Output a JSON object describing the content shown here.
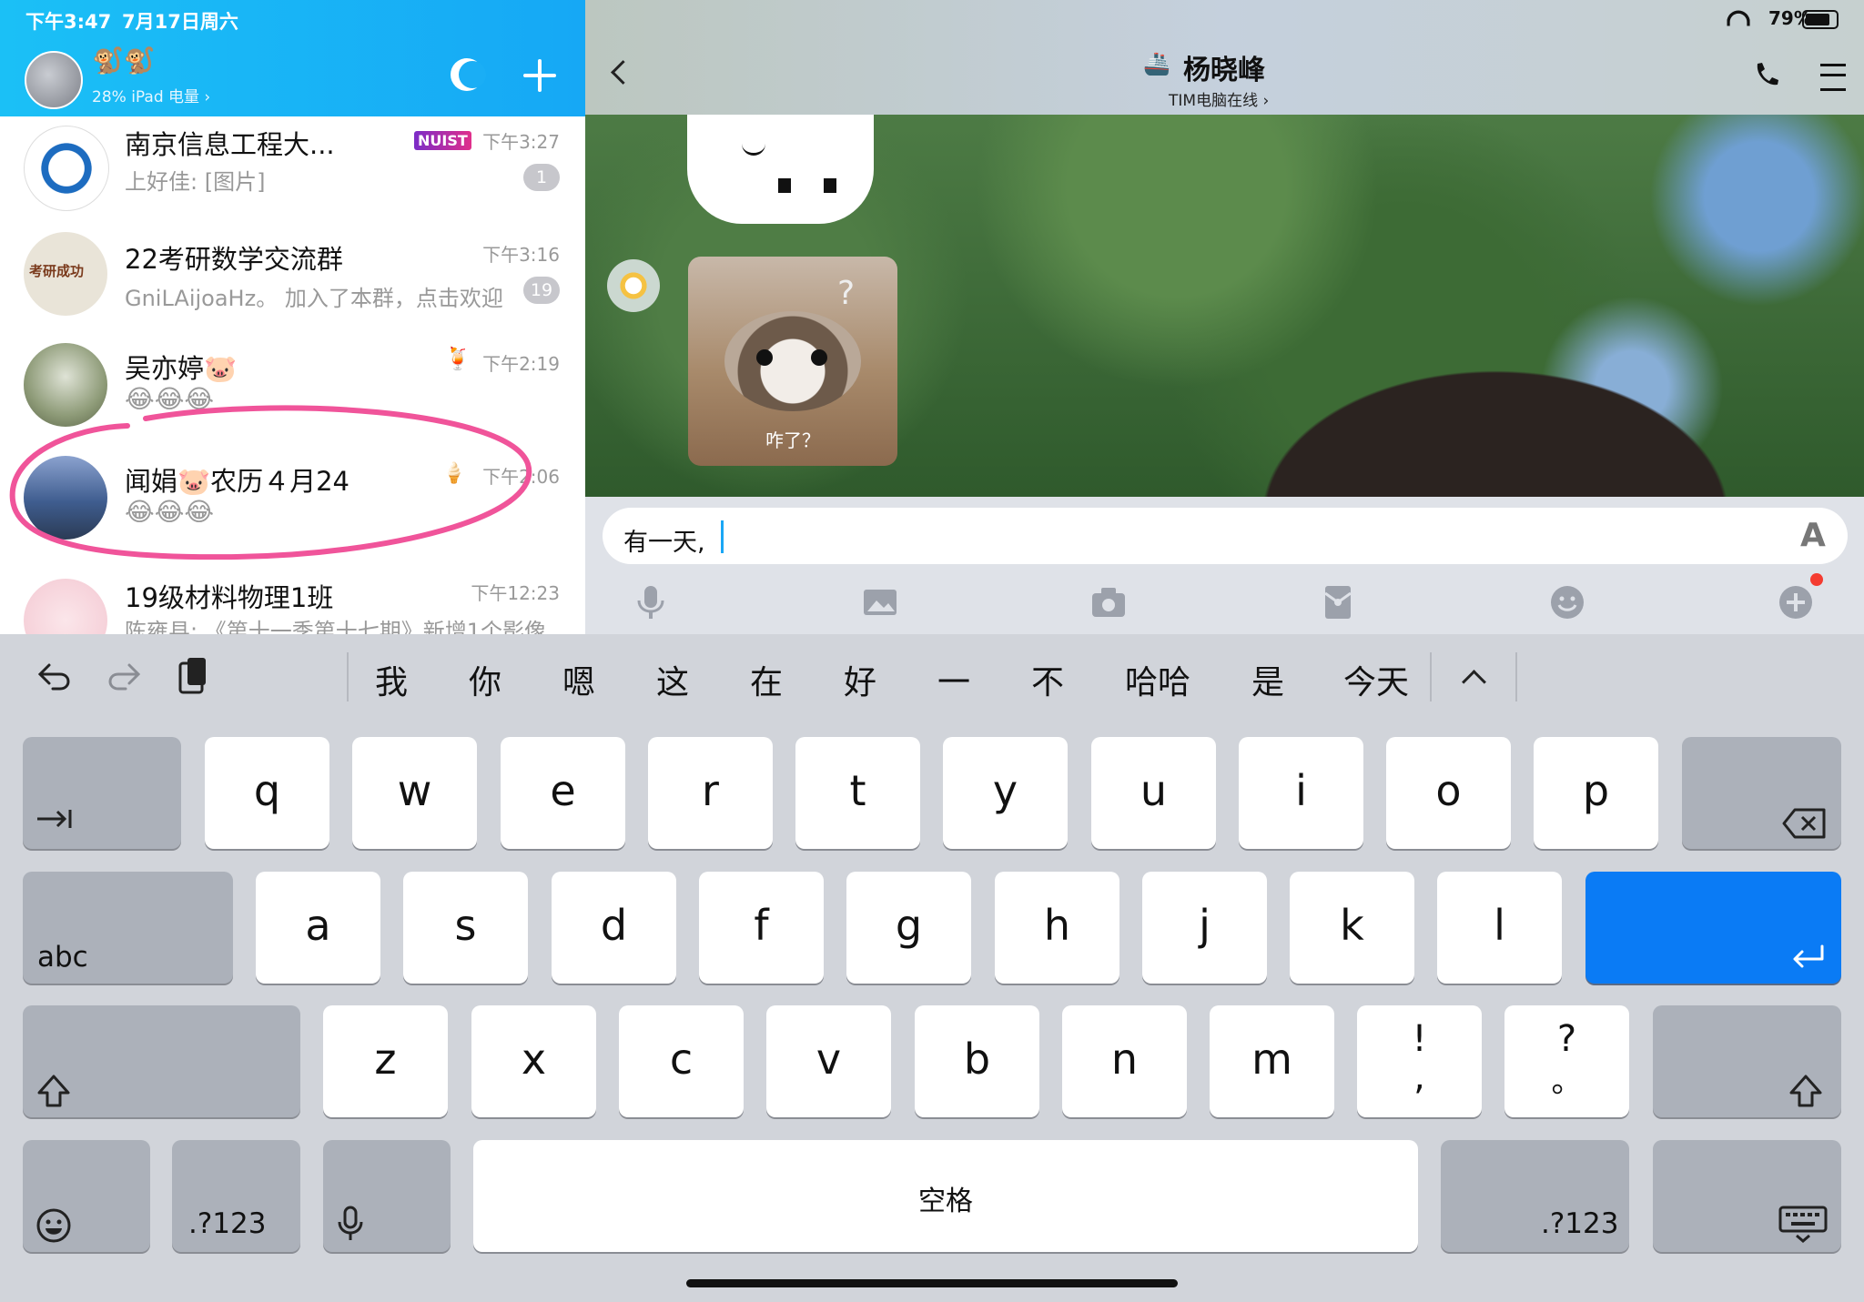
{
  "status_bar": {
    "time": "下午3:47",
    "date": "7月17日周六",
    "battery": "79%"
  },
  "left_header": {
    "device_status": "28% iPad 电量 ›",
    "sub_emoji": "🐒🐒"
  },
  "chats": [
    {
      "name": "南京信息工程大...",
      "preview": "上好佳: [图片]",
      "time": "下午3:27",
      "badge": "1",
      "tag": "NUIST"
    },
    {
      "name": "22考研数学交流群",
      "preview": "GniLAijoaHz。 加入了本群，点击欢迎",
      "time": "下午3:16",
      "badge": "19",
      "avatar_text": "考研成功"
    },
    {
      "name": "吴亦婷🐷",
      "preview": "😂😂😂",
      "time": "下午2:19"
    },
    {
      "name": "闻娟🐷农历４月24",
      "preview": "😂😂😂",
      "time": "下午2:06"
    },
    {
      "name": "19级材料物理1班",
      "preview": "陈雍县: 《第十一季第十七期》新增1个影像",
      "time": "下午12:23"
    }
  ],
  "conversation": {
    "contact_name": "杨晓峰",
    "contact_status": "TIM电脑在线 ›",
    "sticker_caption": "咋了？",
    "input_text": "有一天,"
  },
  "keyboard": {
    "suggestions": [
      "我",
      "你",
      "嗯",
      "这",
      "在",
      "好",
      "一",
      "不",
      "哈哈",
      "是",
      "今天"
    ],
    "row1": [
      "q",
      "w",
      "e",
      "r",
      "t",
      "y",
      "u",
      "i",
      "o",
      "p"
    ],
    "row2": [
      "a",
      "s",
      "d",
      "f",
      "g",
      "h",
      "j",
      "k",
      "l"
    ],
    "row3": [
      "z",
      "x",
      "c",
      "v",
      "b",
      "n",
      "m"
    ],
    "punct1_top": "!",
    "punct1_bottom": ",",
    "punct2_top": "?",
    "punct2_bottom": "。",
    "abc_label": "abc",
    "num_label": ".?123",
    "space_label": "空格"
  },
  "colors": {
    "header_blue": "#16a8f5",
    "return_blue": "#0a7bf5",
    "circle_pink": "#f0549a"
  }
}
